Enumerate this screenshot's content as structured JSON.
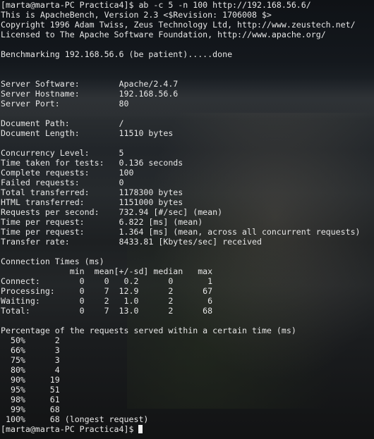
{
  "terminal": {
    "lines": [
      "[marta@marta-PC Practica4]$ ab -c 5 -n 100 http://192.168.56.6/",
      "This is ApacheBench, Version 2.3 <$Revision: 1706008 $>",
      "Copyright 1996 Adam Twiss, Zeus Technology Ltd, http://www.zeustech.net/",
      "Licensed to The Apache Software Foundation, http://www.apache.org/",
      "",
      "Benchmarking 192.168.56.6 (be patient).....done",
      "",
      "",
      "Server Software:        Apache/2.4.7",
      "Server Hostname:        192.168.56.6",
      "Server Port:            80",
      "",
      "Document Path:          /",
      "Document Length:        11510 bytes",
      "",
      "Concurrency Level:      5",
      "Time taken for tests:   0.136 seconds",
      "Complete requests:      100",
      "Failed requests:        0",
      "Total transferred:      1178300 bytes",
      "HTML transferred:       1151000 bytes",
      "Requests per second:    732.94 [#/sec] (mean)",
      "Time per request:       6.822 [ms] (mean)",
      "Time per request:       1.364 [ms] (mean, across all concurrent requests)",
      "Transfer rate:          8433.81 [Kbytes/sec] received",
      "",
      "Connection Times (ms)",
      "              min  mean[+/-sd] median   max",
      "Connect:        0    0   0.2      0       1",
      "Processing:     0    7  12.9      2      67",
      "Waiting:        0    2   1.0      2       6",
      "Total:          0    7  13.0      2      68",
      "",
      "Percentage of the requests served within a certain time (ms)",
      "  50%      2",
      "  66%      3",
      "  75%      3",
      "  80%      4",
      "  90%     19",
      "  95%     51",
      "  98%     61",
      "  99%     68",
      " 100%     68 (longest request)"
    ],
    "prompt": "[marta@marta-PC Practica4]$ "
  }
}
